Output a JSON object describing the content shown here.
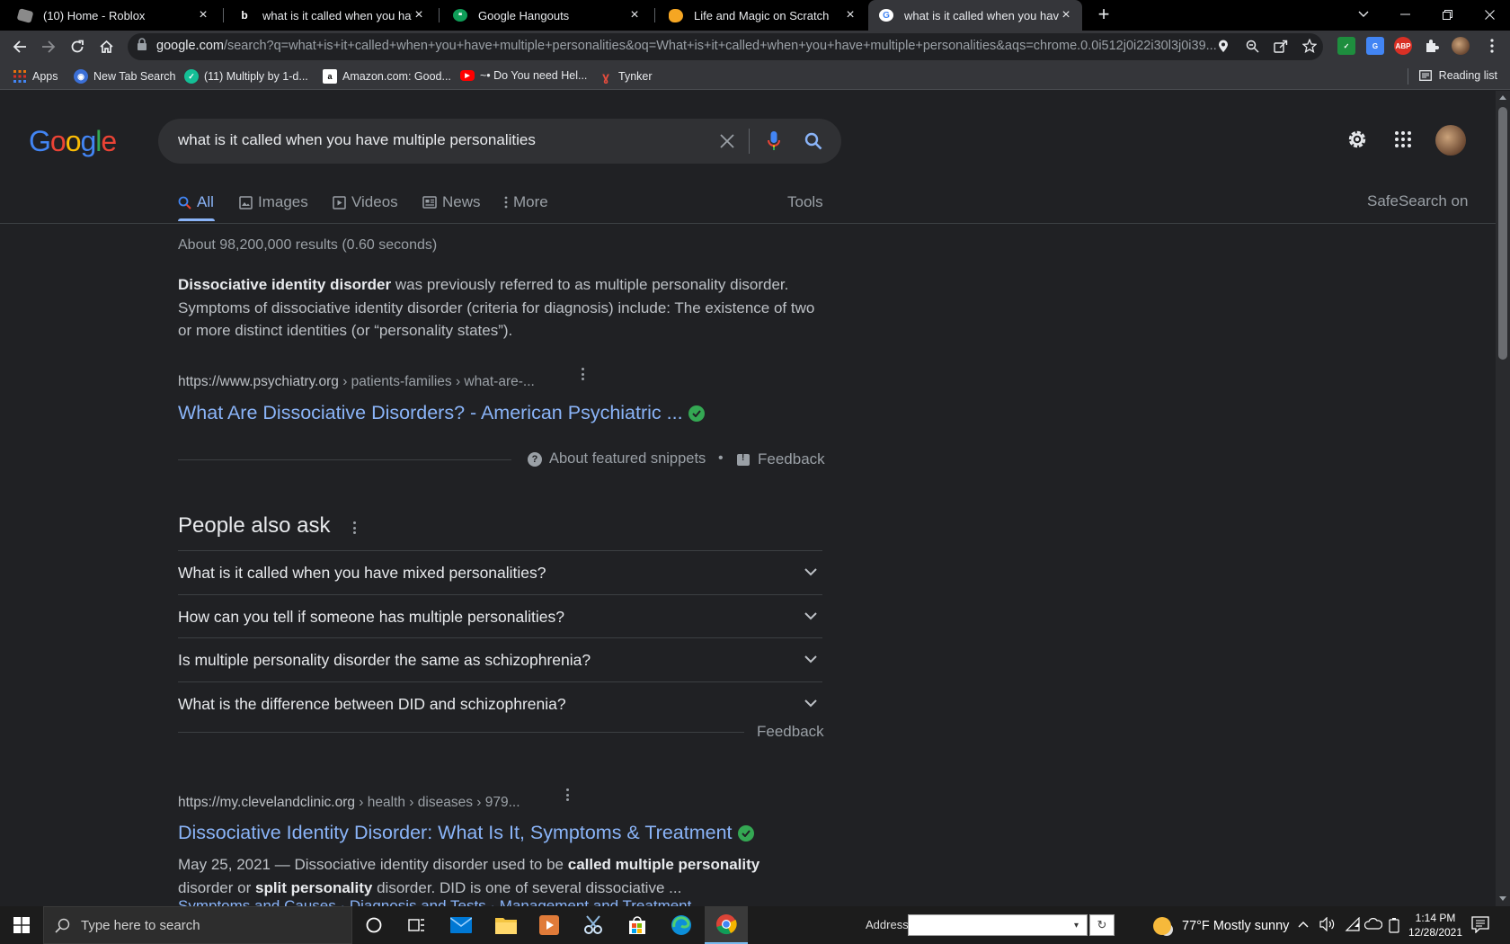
{
  "colors": {
    "background": "#202124",
    "link": "#8ab4f8",
    "text": "#bdc1c6",
    "verified": "#34a853",
    "tabstrip": "#000000",
    "toolbar": "#35363a"
  },
  "browser": {
    "tabs": [
      {
        "title": "(10) Home - Roblox",
        "icon": "roblox-icon",
        "active": false
      },
      {
        "title": "what is it called when you have m",
        "icon": "bing-icon",
        "active": false
      },
      {
        "title": "Google Hangouts",
        "icon": "hangouts-icon",
        "active": false
      },
      {
        "title": "Life and Magic on Scratch",
        "icon": "scratch-icon",
        "active": false
      },
      {
        "title": "what is it called when you have m",
        "icon": "google-icon",
        "active": true
      }
    ],
    "url_host": "google.com",
    "url_path": "/search?q=what+is+it+called+when+you+have+multiple+personalities&oq=What+is+it+called+when+you+have+multiple+personalities&aqs=chrome.0.0i512j0i22i30l3j0i39...",
    "bookmarks": [
      {
        "label": "Apps",
        "icon": "apps-grid-icon"
      },
      {
        "label": "New Tab Search",
        "icon": "globe-icon"
      },
      {
        "label": "(11) Multiply by 1-d...",
        "icon": "khan-academy-icon"
      },
      {
        "label": "Amazon.com: Good...",
        "icon": "amazon-icon"
      },
      {
        "label": "~• Do You need Hel...",
        "icon": "youtube-icon"
      },
      {
        "label": "Tynker",
        "icon": "tynker-icon"
      }
    ],
    "reading_list": "Reading list"
  },
  "google": {
    "logo": "Google",
    "query": "what is it called when you have multiple personalities",
    "tabs": [
      {
        "label": "All",
        "icon": "search-icon"
      },
      {
        "label": "Images",
        "icon": "image-icon"
      },
      {
        "label": "Videos",
        "icon": "video-icon"
      },
      {
        "label": "News",
        "icon": "news-icon"
      },
      {
        "label": "More",
        "icon": "dots-vertical-icon"
      }
    ],
    "tools": "Tools",
    "safesearch": "SafeSearch on",
    "result_stats": "About 98,200,000 results (0.60 seconds)",
    "featured": {
      "bold_term": "Dissociative identity disorder",
      "text": " was previously referred to as multiple personality disorder. Symptoms of dissociative identity disorder (criteria for diagnosis) include: The existence of two or more distinct identities (or “personality states”).",
      "cite_host": "https://www.psychiatry.org",
      "cite_path": " › patients-families › what-are-...",
      "title": "What Are Dissociative Disorders? - American Psychiatric ...",
      "about": "About featured snippets",
      "separator": "•",
      "feedback": "Feedback"
    },
    "people_also_ask": {
      "title": "People also ask",
      "questions": [
        "What is it called when you have mixed personalities?",
        "How can you tell if someone has multiple personalities?",
        "Is multiple personality disorder the same as schizophrenia?",
        "What is the difference between DID and schizophrenia?"
      ],
      "feedback": "Feedback"
    },
    "result": {
      "cite_host": "https://my.clevelandclinic.org",
      "cite_path": " › health › diseases › 979...",
      "title": "Dissociative Identity Disorder: What Is It, Symptoms & Treatment",
      "date": "May 25, 2021",
      "snippet_parts": [
        " — Dissociative identity disorder used to be ",
        "called multiple personality",
        " disorder or ",
        "split personality",
        " disorder. DID is one of several dissociative ..."
      ],
      "cut_links": "Symptoms and Causes · Diagnosis and Tests · Management and Treatment"
    }
  },
  "taskbar": {
    "search_placeholder": "Type here to search",
    "address_label": "Address",
    "weather": "77°F  Mostly sunny",
    "time": "1:14 PM",
    "date": "12/28/2021"
  }
}
